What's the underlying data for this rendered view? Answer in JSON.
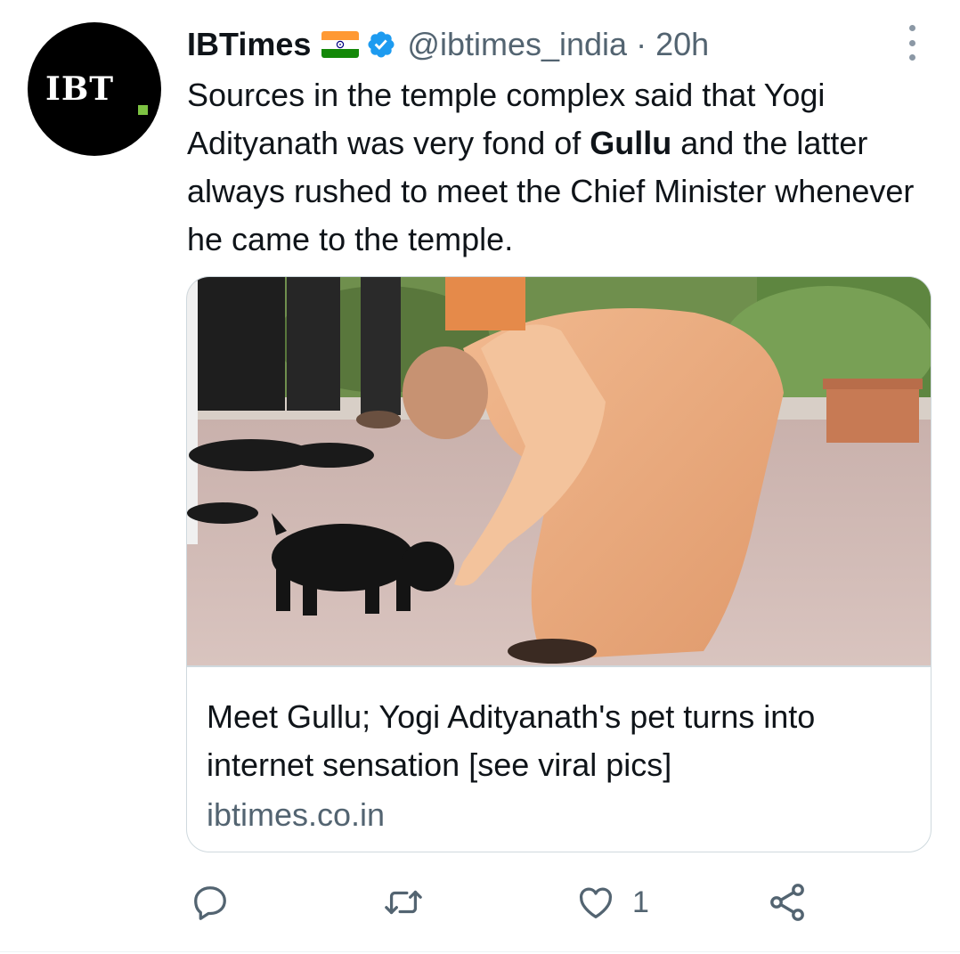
{
  "tweet": {
    "avatar_text": "IBT",
    "author_name": "IBTimes",
    "handle": "@ibtimes_india",
    "separator": " · ",
    "time": "20h",
    "text_part1": "Sources in the temple complex said that Yogi Adityanath was very fond of ",
    "text_bold": "Gullu",
    "text_part2": " and the latter always rushed to meet the Chief Minister whenever he came to the temple.",
    "flag_icon": "india-flag-icon",
    "verified_icon": "verified-badge-icon"
  },
  "card": {
    "title": "Meet Gullu; Yogi Adityanath's pet turns into internet sensation [see viral pics]",
    "domain": "ibtimes.co.in"
  },
  "actions": {
    "reply_icon": "reply-icon",
    "retweet_icon": "retweet-icon",
    "like_icon": "heart-icon",
    "like_count": "1",
    "share_icon": "share-icon"
  },
  "colors": {
    "text": "#0f1419",
    "secondary": "#536471",
    "verified": "#1d9bf0",
    "border": "#cfd9de",
    "brand_dot": "#7dc242"
  }
}
